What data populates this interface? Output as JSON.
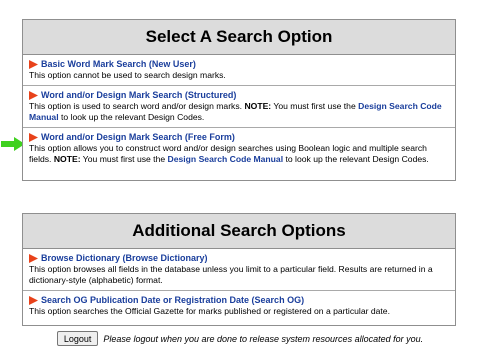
{
  "panel1": {
    "title": "Select A Search Option",
    "options": [
      {
        "title": "Basic Word Mark Search (New User)",
        "desc": "This option cannot be used to search design marks."
      },
      {
        "title": "Word and/or Design Mark Search (Structured)",
        "desc_pre": "This option is used to search word and/or design marks. ",
        "note_label": "NOTE:",
        "desc_mid": " You must first use the ",
        "link": "Design Search Code Manual",
        "desc_post": " to look up the relevant Design Codes."
      },
      {
        "title": "Word and/or Design Mark Search (Free Form)",
        "desc_pre": "This option allows you to construct word and/or design searches using Boolean logic and multiple search fields. ",
        "note_label": "NOTE:",
        "desc_mid": " You must first use the ",
        "link": "Design Search Code Manual",
        "desc_post": " to look up the relevant Design Codes."
      }
    ]
  },
  "panel2": {
    "title": "Additional Search Options",
    "options": [
      {
        "title": "Browse Dictionary (Browse Dictionary)",
        "desc": "This option browses all fields in the database unless you limit to a particular field. Results are returned in a dictionary-style (alphabetic) format."
      },
      {
        "title": "Search OG Publication Date or Registration Date (Search OG)",
        "desc": "This option searches the Official Gazette for marks published or registered on a particular date."
      }
    ]
  },
  "footer": {
    "logout_label": "Logout",
    "note": "Please logout when you are done to release system resources allocated for you."
  },
  "icons": {
    "option_marker": "red-flag-icon",
    "pointer": "green-arrow-icon"
  },
  "colors": {
    "link": "#1a3e9c",
    "flag": "#e8421a",
    "arrow": "#3fd11f",
    "header_bg": "#dcdcdc"
  }
}
